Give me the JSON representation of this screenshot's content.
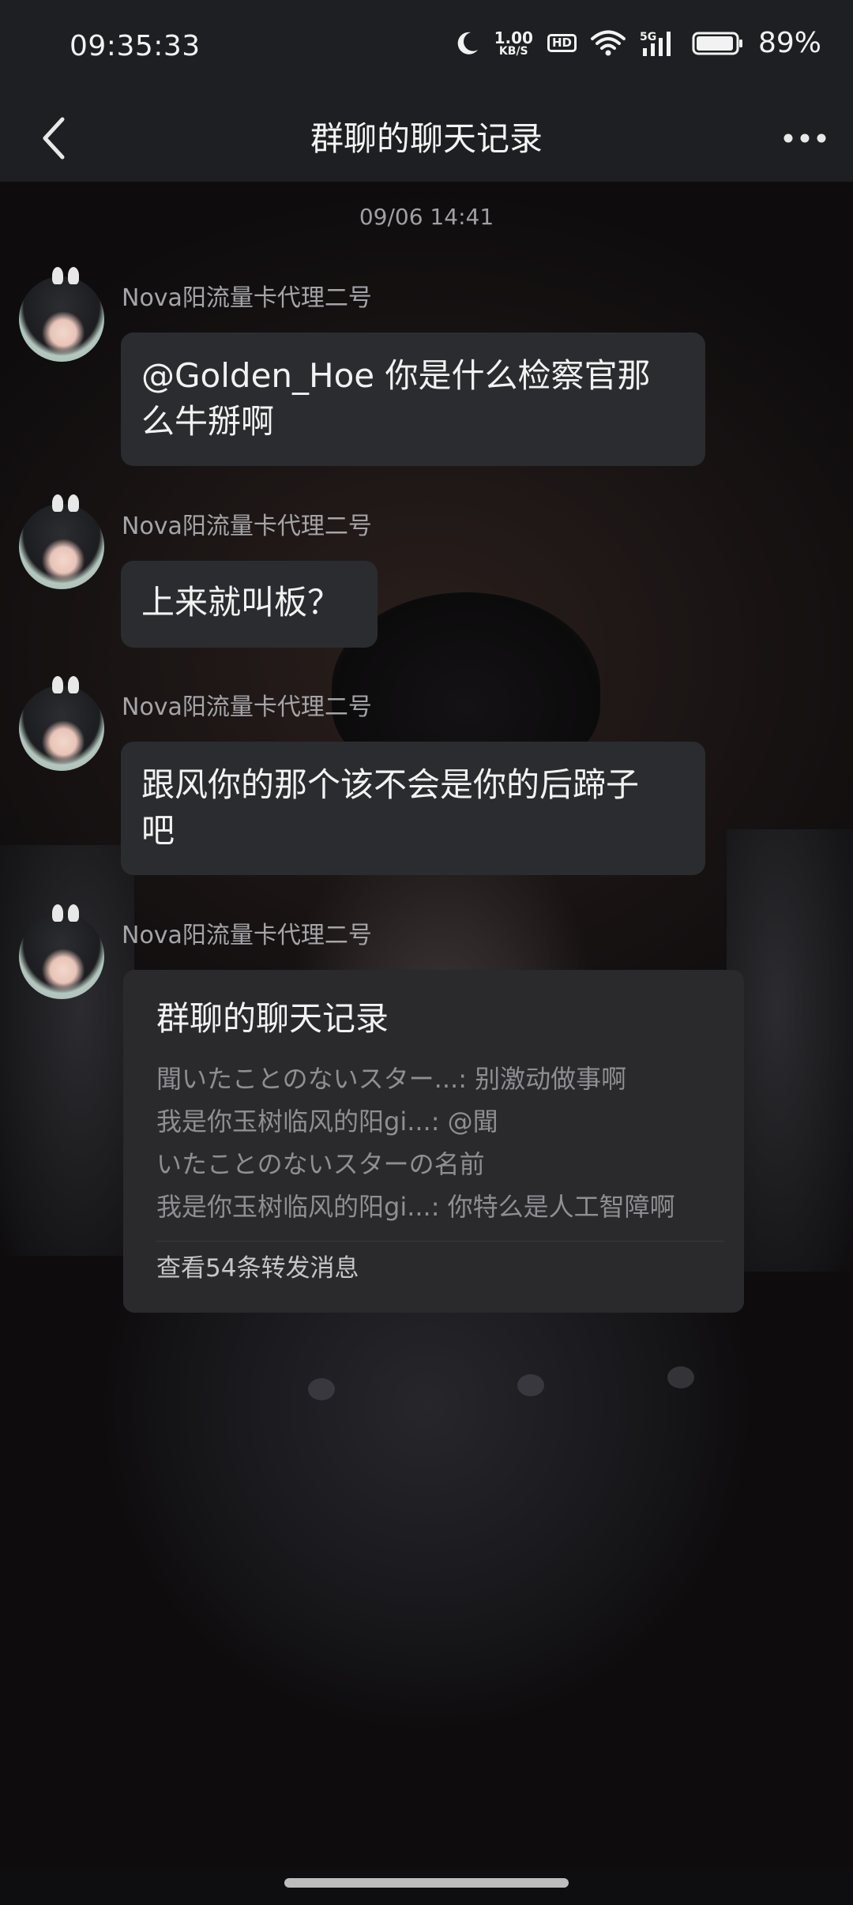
{
  "status_bar": {
    "time": "09:35:33",
    "net_speed_value": "1.00",
    "net_speed_unit": "KB/S",
    "hd_label": "HD",
    "signal_label": "5G",
    "battery_percent": "89%"
  },
  "nav": {
    "title": "群聊的聊天记录",
    "back_icon": "chevron-left-icon",
    "more_icon": "more-horizontal-icon"
  },
  "chat": {
    "timestamp": "09/06 14:41",
    "messages": [
      {
        "sender": "Nova阳流量卡代理二号",
        "lines": [
          "@Golden_Hoe 你是什么检察官那",
          "么牛掰啊"
        ]
      },
      {
        "sender": "Nova阳流量卡代理二号",
        "lines": [
          "上来就叫板？"
        ]
      },
      {
        "sender": "Nova阳流量卡代理二号",
        "lines": [
          "跟风你的那个该不会是你的后蹄子",
          "吧"
        ]
      },
      {
        "sender": "Nova阳流量卡代理二号"
      }
    ],
    "forward_card": {
      "title": "群聊的聊天记录",
      "lines": [
        "聞いたことのないスター...:  别激动做事啊",
        "我是你玉树临风的阳gi...:  @聞",
        "いたことのないスターの名前",
        "我是你玉树临风的阳gi...:  你特么是人工智障啊"
      ],
      "footer": "查看54条转发消息"
    }
  }
}
